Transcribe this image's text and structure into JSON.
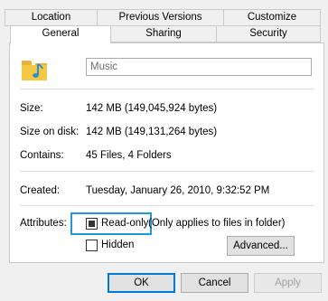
{
  "tabs_back": [
    "Location",
    "Previous Versions",
    "Customize"
  ],
  "tabs_front": [
    "General",
    "Sharing",
    "Security"
  ],
  "active_tab": "General",
  "folder": {
    "icon": "music-folder-icon",
    "name_value": "Music"
  },
  "properties": {
    "size_label": "Size:",
    "size_value": "142 MB (149,045,924 bytes)",
    "size_on_disk_label": "Size on disk:",
    "size_on_disk_value": "142 MB (149,131,264 bytes)",
    "contains_label": "Contains:",
    "contains_value": "45 Files, 4 Folders",
    "created_label": "Created:",
    "created_value": "Tuesday, January 26, 2010, 9:32:52 PM"
  },
  "attributes": {
    "label": "Attributes:",
    "readonly_label": "Read-only",
    "readonly_state": "indeterminate",
    "readonly_note": "(Only applies to files in folder)",
    "hidden_label": "Hidden",
    "hidden_checked": false,
    "advanced_button": "Advanced..."
  },
  "buttons": {
    "ok": "OK",
    "cancel": "Cancel",
    "apply": "Apply"
  },
  "colors": {
    "highlight": "#1e9bd7",
    "folder_yellow": "#f5c842",
    "note_blue": "#2b8fd6"
  }
}
